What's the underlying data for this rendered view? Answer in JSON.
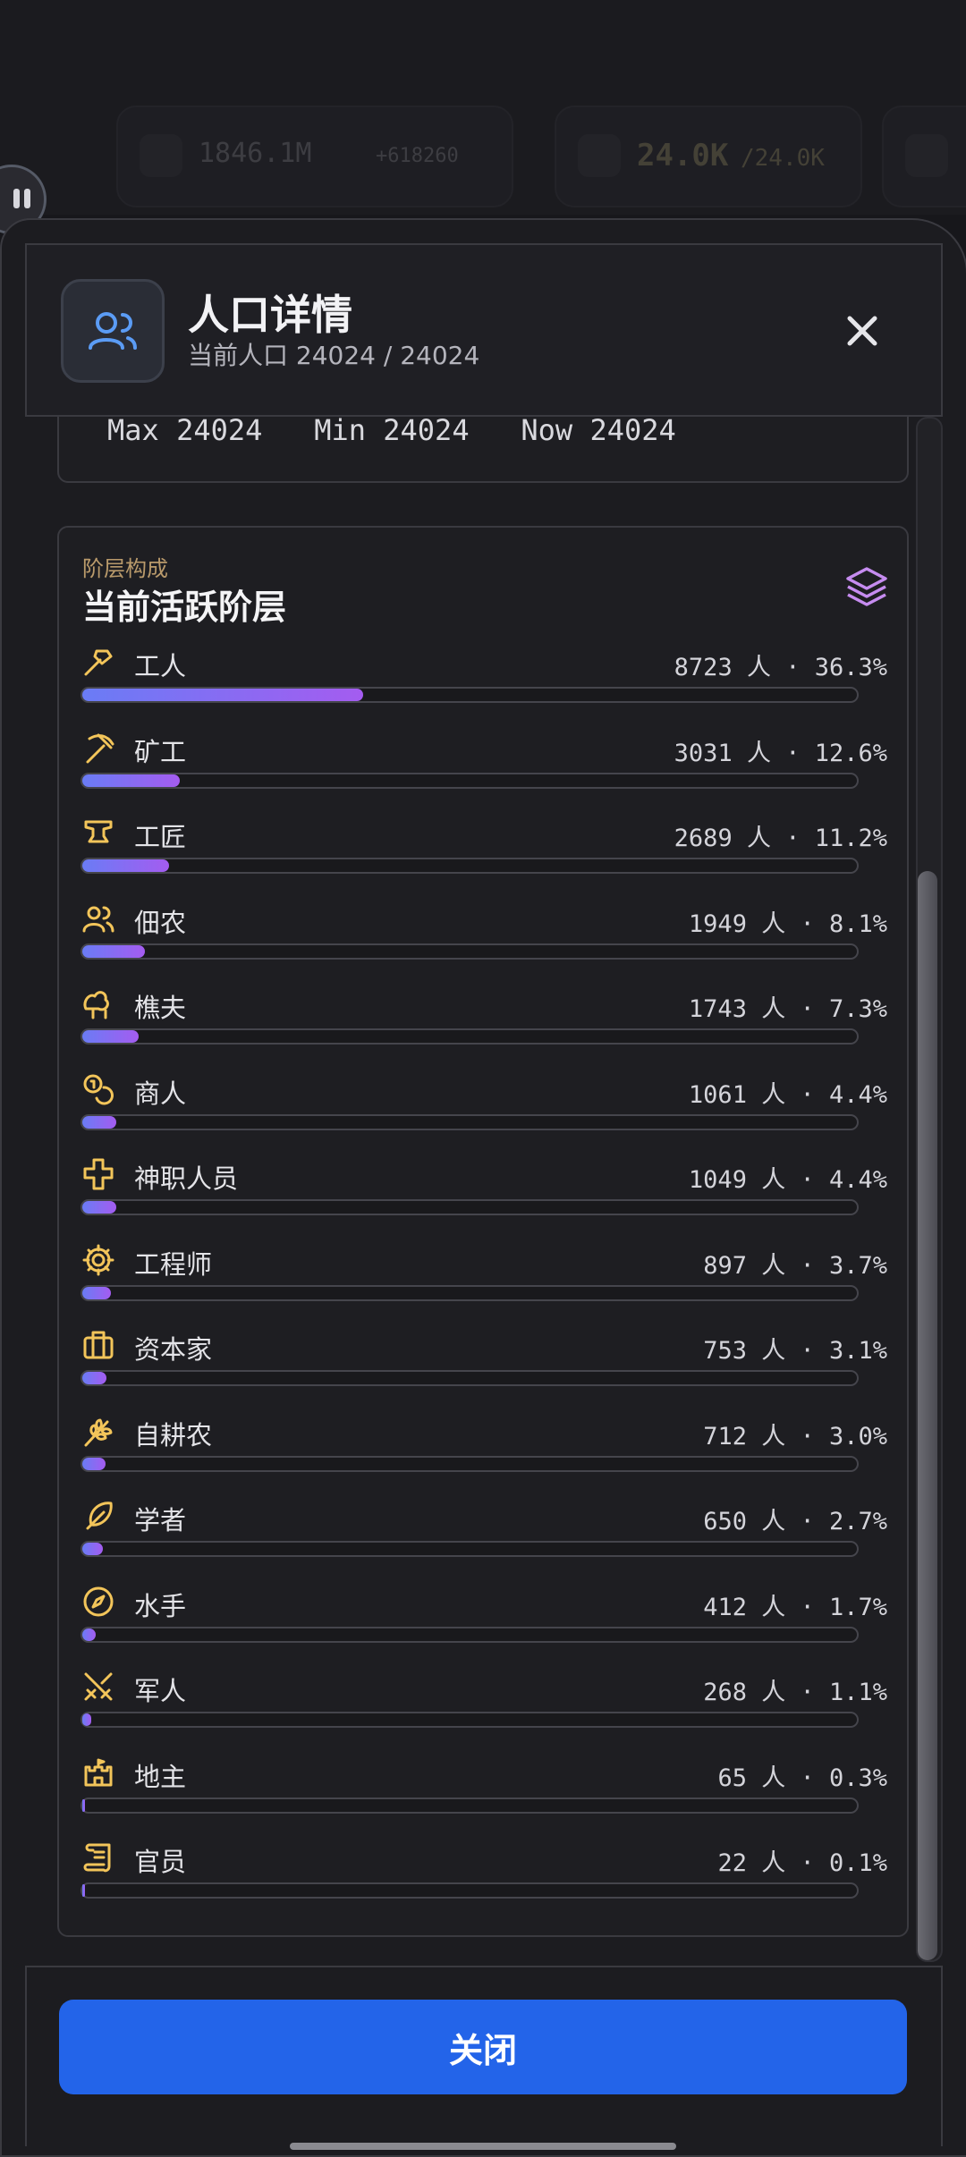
{
  "background": {
    "coin_value": "1846.1M",
    "coin_delta": "+618260",
    "population_short": "24.0K",
    "population_cap_short": "/24.0K"
  },
  "modal": {
    "title": "人口详情",
    "subtitle": "当前人口 24024 / 24024",
    "stats": {
      "max_label": "Max",
      "max": "24024",
      "min_label": "Min",
      "min": "24024",
      "now_label": "Now",
      "now": "24024"
    },
    "section_kicker": "阶层构成",
    "section_title": "当前活跃阶层",
    "close_button": "关闭",
    "strata": [
      {
        "name": "工人",
        "value": "8723 人 · 36.3%",
        "percent": 36.3,
        "icon": "hammer-icon"
      },
      {
        "name": "矿工",
        "value": "3031 人 · 12.6%",
        "percent": 12.6,
        "icon": "pickaxe-icon"
      },
      {
        "name": "工匠",
        "value": "2689 人 · 11.2%",
        "percent": 11.2,
        "icon": "anvil-icon"
      },
      {
        "name": "佃农",
        "value": "1949 人 · 8.1%",
        "percent": 8.1,
        "icon": "users-icon"
      },
      {
        "name": "樵夫",
        "value": "1743 人 · 7.3%",
        "percent": 7.3,
        "icon": "trees-icon"
      },
      {
        "name": "商人",
        "value": "1061 人 · 4.4%",
        "percent": 4.4,
        "icon": "coins-icon"
      },
      {
        "name": "神职人员",
        "value": "1049 人 · 4.4%",
        "percent": 4.4,
        "icon": "cross-icon"
      },
      {
        "name": "工程师",
        "value": "897 人 · 3.7%",
        "percent": 3.7,
        "icon": "cog-icon"
      },
      {
        "name": "资本家",
        "value": "753 人 · 3.1%",
        "percent": 3.1,
        "icon": "briefcase-icon"
      },
      {
        "name": "自耕农",
        "value": "712 人 · 3.0%",
        "percent": 3.0,
        "icon": "wheat-icon"
      },
      {
        "name": "学者",
        "value": "650 人 · 2.7%",
        "percent": 2.7,
        "icon": "feather-icon"
      },
      {
        "name": "水手",
        "value": "412 人 · 1.7%",
        "percent": 1.7,
        "icon": "compass-icon"
      },
      {
        "name": "军人",
        "value": "268 人 · 1.1%",
        "percent": 1.1,
        "icon": "swords-icon"
      },
      {
        "name": "地主",
        "value": "65 人 · 0.3%",
        "percent": 0.3,
        "icon": "castle-icon"
      },
      {
        "name": "官员",
        "value": "22 人 · 0.1%",
        "percent": 0.1,
        "icon": "scroll-icon"
      }
    ]
  },
  "colors": {
    "accent": "#2364e9",
    "icon_gold": "#f3c55a",
    "bar_start": "#6a7cf5",
    "bar_end": "#a45cf0"
  }
}
